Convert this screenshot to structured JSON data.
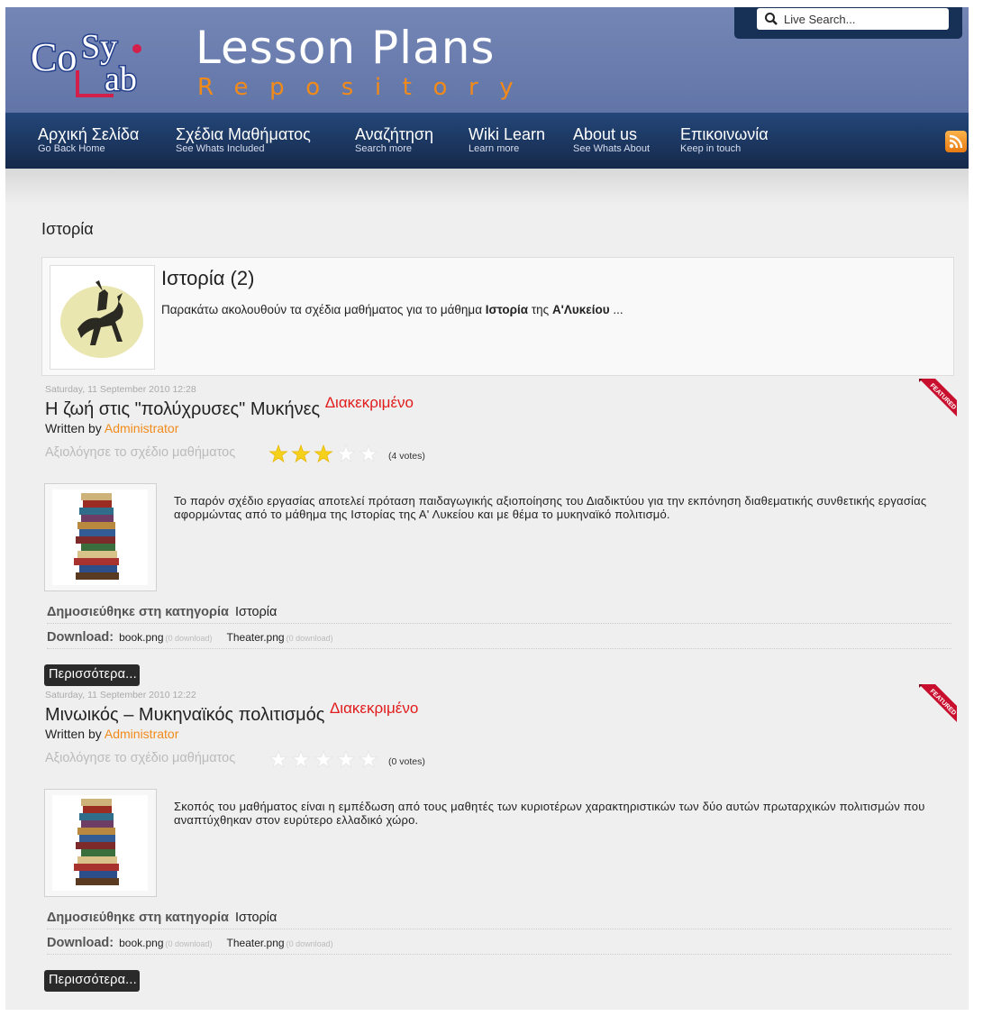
{
  "header": {
    "title": "Lesson Plans",
    "subtitle": "Repository",
    "search_placeholder": "Live Search...",
    "colors": {
      "header_bg": "#6275a8",
      "nav_bg": "#1d3560",
      "accent": "#f28a1a",
      "featured": "#e11b1b"
    }
  },
  "nav": {
    "items": [
      {
        "label": "Αρχική Σελίδα",
        "sub": "Go Back Home"
      },
      {
        "label": "Σχέδια Μαθήματος",
        "sub": "See Whats Included"
      },
      {
        "label": "Αναζήτηση",
        "sub": "Search more"
      },
      {
        "label": "Wiki Learn",
        "sub": "Learn more"
      },
      {
        "label": "About us",
        "sub": "See Whats About"
      },
      {
        "label": "Επικοινωνία",
        "sub": "Keep in touch"
      }
    ]
  },
  "page": {
    "heading": "Ιστορία",
    "category": {
      "title": "Ιστορία (2)",
      "desc_pre": "Παρακάτω ακολουθούν τα σχέδια μαθήματος για το μάθημα ",
      "desc_bold1": "Ιστορία",
      "desc_mid": " της ",
      "desc_bold2": "Α'Λυκείου",
      "desc_post": " ..."
    }
  },
  "articles": [
    {
      "date": "Saturday, 11 September 2010 12:28",
      "title": "Η ζωή στις \"πολύχρυσες\" Μυκήνες",
      "featured_label": "Διακεκριμένο",
      "written_by": "Written by",
      "author": "Administrator",
      "rate_label": "Αξιολόγησε το σχέδιο μαθήματος",
      "rating": 3,
      "rating_max": 5,
      "votes": "(4 votes)",
      "ribbon": "FEATURED",
      "intro": "Το παρόν σχέδιο εργασίας αποτελεί πρόταση παιδαγωγικής αξιοποίησης του Διαδικτύου για την εκπόνηση διαθεματικής συνθετικής εργασίας αφορμώντας από το μάθημα της Ιστορίας της Α' Λυκείου και με θέμα το μυκηναϊκό πολιτισμό.",
      "category_label": "Δημοσιεύθηκε στη κατηγορία",
      "category": "Ιστορία",
      "download_label": "Download:",
      "files": [
        {
          "name": "book.png",
          "count": "(0 download)"
        },
        {
          "name": "Theater.png",
          "count": "(0 download)"
        }
      ],
      "more": "Περισσότερα..."
    },
    {
      "date": "Saturday, 11 September 2010 12:22",
      "title": "Μινωικός – Μυκηναϊκός πολιτισμός",
      "featured_label": "Διακεκριμένο",
      "written_by": "Written by",
      "author": "Administrator",
      "rate_label": "Αξιολόγησε το σχέδιο μαθήματος",
      "rating": 0,
      "rating_max": 5,
      "votes": "(0 votes)",
      "ribbon": "FEATURED",
      "intro": "Σκοπός του μαθήματος είναι η εμπέδωση από τους μαθητές των κυριοτέρων χαρακτηριστικών των δύο αυτών πρωταρχικών πολιτισμών που αναπτύχθηκαν στον ευρύτερο ελλαδικό χώρο.",
      "category_label": "Δημοσιεύθηκε στη κατηγορία",
      "category": "Ιστορία",
      "download_label": "Download:",
      "files": [
        {
          "name": "book.png",
          "count": "(0 download)"
        },
        {
          "name": "Theater.png",
          "count": "(0 download)"
        }
      ],
      "more": "Περισσότερα..."
    }
  ]
}
